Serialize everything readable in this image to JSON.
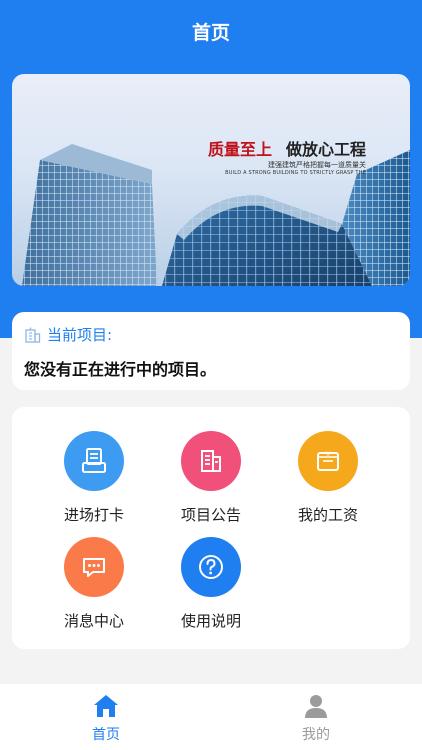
{
  "header": {
    "title": "首页"
  },
  "banner": {
    "slogan_red": "质量至上",
    "slogan_black": "做放心工程",
    "subline_cn": "建强建筑严格把握每一道质量关",
    "subline_en": "BUILD A STRONG BUILDING TO STRICTLY GRASP THE"
  },
  "project": {
    "label": "当前项目:",
    "status": "您没有正在进行中的项目。"
  },
  "menu": {
    "items": [
      {
        "label": "进场打卡",
        "icon": "clipboard-icon",
        "color": "#3d9cf2"
      },
      {
        "label": "项目公告",
        "icon": "building-icon",
        "color": "#f0507a"
      },
      {
        "label": "我的工资",
        "icon": "wallet-icon",
        "color": "#f5a81c"
      },
      {
        "label": "消息中心",
        "icon": "chat-icon",
        "color": "#fb7a4a"
      },
      {
        "label": "使用说明",
        "icon": "help-icon",
        "color": "#1f7ff0"
      }
    ]
  },
  "tabbar": {
    "tabs": [
      {
        "label": "首页",
        "icon": "home-icon",
        "active": true
      },
      {
        "label": "我的",
        "icon": "user-icon",
        "active": false
      }
    ],
    "active_color": "#1f7ff0",
    "inactive_color": "#9b9b9b"
  }
}
